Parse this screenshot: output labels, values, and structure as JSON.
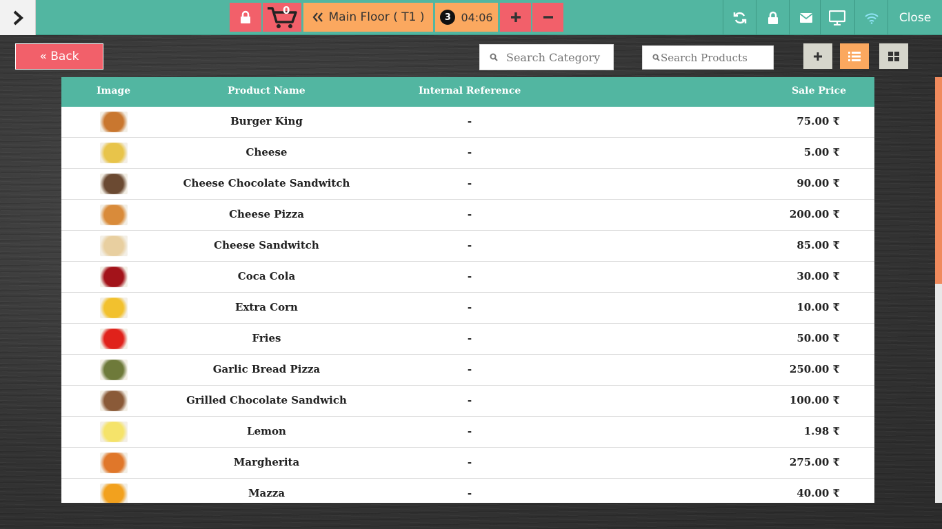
{
  "colors": {
    "teal": "#52b6a1",
    "red": "#f2606a",
    "orange": "#fba85f",
    "grey_button": "#d6d6cc"
  },
  "topbar": {
    "cart_count": "0",
    "floor_label": "Main Floor ( T1 )",
    "order_badge": "3",
    "timer": "04:06",
    "close_label": "Close",
    "icons": [
      "chevron-right-icon",
      "lock-icon",
      "cart-icon",
      "double-chevron-left-icon",
      "plus-icon",
      "minus-icon",
      "refresh-icon",
      "lock-icon",
      "envelope-icon",
      "monitor-icon",
      "wifi-icon"
    ]
  },
  "toolbar": {
    "back_label": "« Back",
    "search_category_placeholder": "Search Category",
    "search_products_placeholder": "Search Products"
  },
  "table": {
    "headers": {
      "image": "Image",
      "name": "Product Name",
      "ref": "Internal Reference",
      "price": "Sale Price"
    },
    "rows": [
      {
        "name": "Burger King",
        "ref": "-",
        "price": "75.00 ₹",
        "thumb_color": "#c9772f"
      },
      {
        "name": "Cheese",
        "ref": "-",
        "price": "5.00 ₹",
        "thumb_color": "#e8c44a"
      },
      {
        "name": "Cheese Chocolate Sandwitch",
        "ref": "-",
        "price": "90.00 ₹",
        "thumb_color": "#6b4a32"
      },
      {
        "name": "Cheese Pizza",
        "ref": "-",
        "price": "200.00 ₹",
        "thumb_color": "#d98b3a"
      },
      {
        "name": "Cheese Sandwitch",
        "ref": "-",
        "price": "85.00 ₹",
        "thumb_color": "#e8cfa0"
      },
      {
        "name": "Coca Cola",
        "ref": "-",
        "price": "30.00 ₹",
        "thumb_color": "#a3131a"
      },
      {
        "name": "Extra Corn",
        "ref": "-",
        "price": "10.00 ₹",
        "thumb_color": "#f2c12e"
      },
      {
        "name": "Fries",
        "ref": "-",
        "price": "50.00 ₹",
        "thumb_color": "#e0221b"
      },
      {
        "name": "Garlic Bread Pizza",
        "ref": "-",
        "price": "250.00 ₹",
        "thumb_color": "#6e7a3a"
      },
      {
        "name": "Grilled Chocolate Sandwich",
        "ref": "-",
        "price": "100.00 ₹",
        "thumb_color": "#8a5a38"
      },
      {
        "name": "Lemon",
        "ref": "-",
        "price": "1.98 ₹",
        "thumb_color": "#f5e36a"
      },
      {
        "name": "Margherita",
        "ref": "-",
        "price": "275.00 ₹",
        "thumb_color": "#e0772a"
      },
      {
        "name": "Mazza",
        "ref": "-",
        "price": "40.00 ₹",
        "thumb_color": "#f2a11e"
      }
    ]
  }
}
